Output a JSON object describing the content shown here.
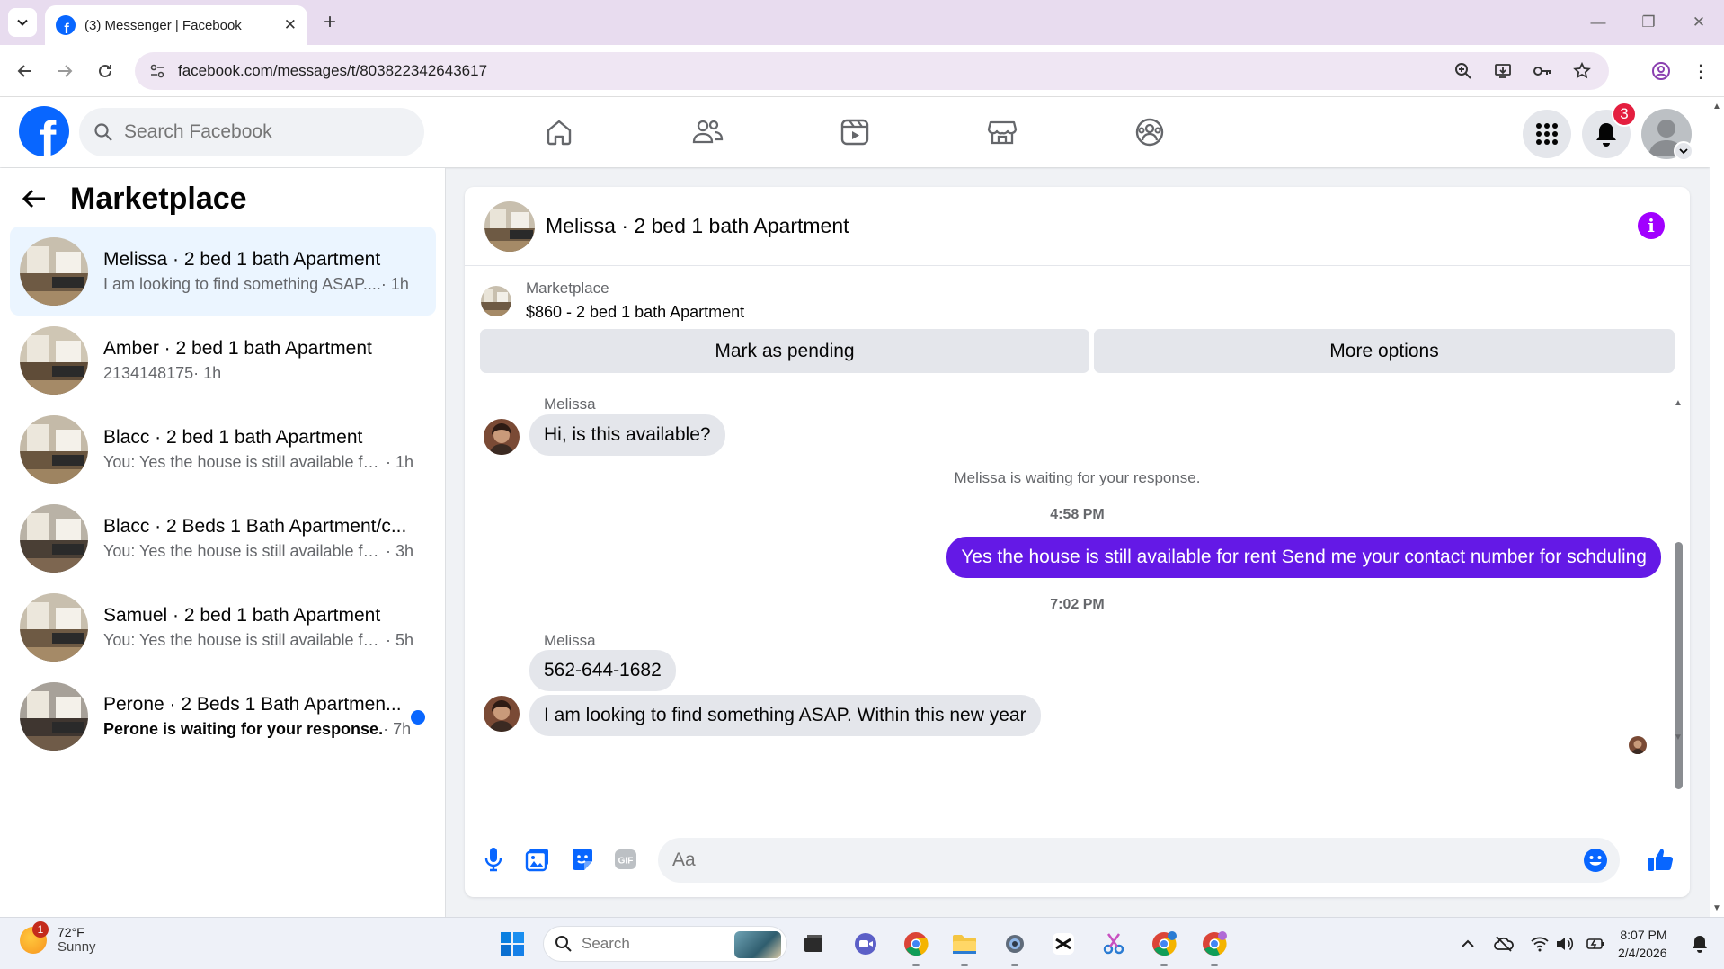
{
  "browser": {
    "tab_title": "(3) Messenger | Facebook",
    "url": "facebook.com/messages/t/803822342643617"
  },
  "fb_header": {
    "search_placeholder": "Search Facebook",
    "notification_count": "3",
    "nav_icons": [
      "home-icon",
      "friends-icon",
      "video-icon",
      "marketplace-icon",
      "groups-icon"
    ]
  },
  "left_panel": {
    "title": "Marketplace",
    "conversations": [
      {
        "name": "Melissa · 2 bed 1 bath Apartment",
        "snippet": "I am looking to find something ASAP....",
        "time": "· 1h",
        "active": true,
        "unread": false
      },
      {
        "name": "Amber · 2 bed 1 bath Apartment",
        "snippet": "2134148175",
        "time": "· 1h",
        "active": false,
        "unread": false
      },
      {
        "name": "Blacc · 2 bed 1 bath Apartment",
        "snippet": "You: Yes the house is still available for ...",
        "time": "· 1h",
        "active": false,
        "unread": false
      },
      {
        "name": "Blacc · 2 Beds 1 Bath Apartment/c...",
        "snippet": "You: Yes the house is still available for ...",
        "time": "· 3h",
        "active": false,
        "unread": false
      },
      {
        "name": "Samuel · 2 bed 1 bath Apartment",
        "snippet": "You: Yes the house is still available for ...",
        "time": "· 5h",
        "active": false,
        "unread": false
      },
      {
        "name": "Perone · 2 Beds 1 Bath Apartmen...",
        "snippet": "Perone is waiting for your response.",
        "time": "· 7h",
        "active": false,
        "unread": true
      }
    ]
  },
  "chat": {
    "title": "Melissa · 2 bed 1 bath Apartment",
    "listing_category": "Marketplace",
    "listing_title": "$860 - 2 bed 1 bath Apartment",
    "mark_pending_label": "Mark as pending",
    "more_options_label": "More options",
    "messages": {
      "sender_1": "Melissa",
      "msg_1": "Hi, is this available?",
      "waiting_note": "Melissa is waiting for your response.",
      "time_1": "4:58 PM",
      "reply_1": "Yes the house is still available for rent Send me your contact number for schduling",
      "time_2": "7:02 PM",
      "sender_2": "Melissa",
      "msg_2": "562-644-1682",
      "msg_3": "I am looking to find something ASAP. Within this new year"
    },
    "composer_placeholder": "Aa",
    "gif_label": "GIF"
  },
  "taskbar": {
    "weather_temp": "72°F",
    "weather_cond": "Sunny",
    "weather_badge": "1",
    "search_placeholder": "Search",
    "time": "8:07 PM",
    "date": "2/4/2026"
  },
  "colors": {
    "fb_blue": "#0866ff",
    "outgoing_bubble": "#6419e6",
    "info_purple": "#a100ff",
    "badge_red": "#e41e3f"
  }
}
